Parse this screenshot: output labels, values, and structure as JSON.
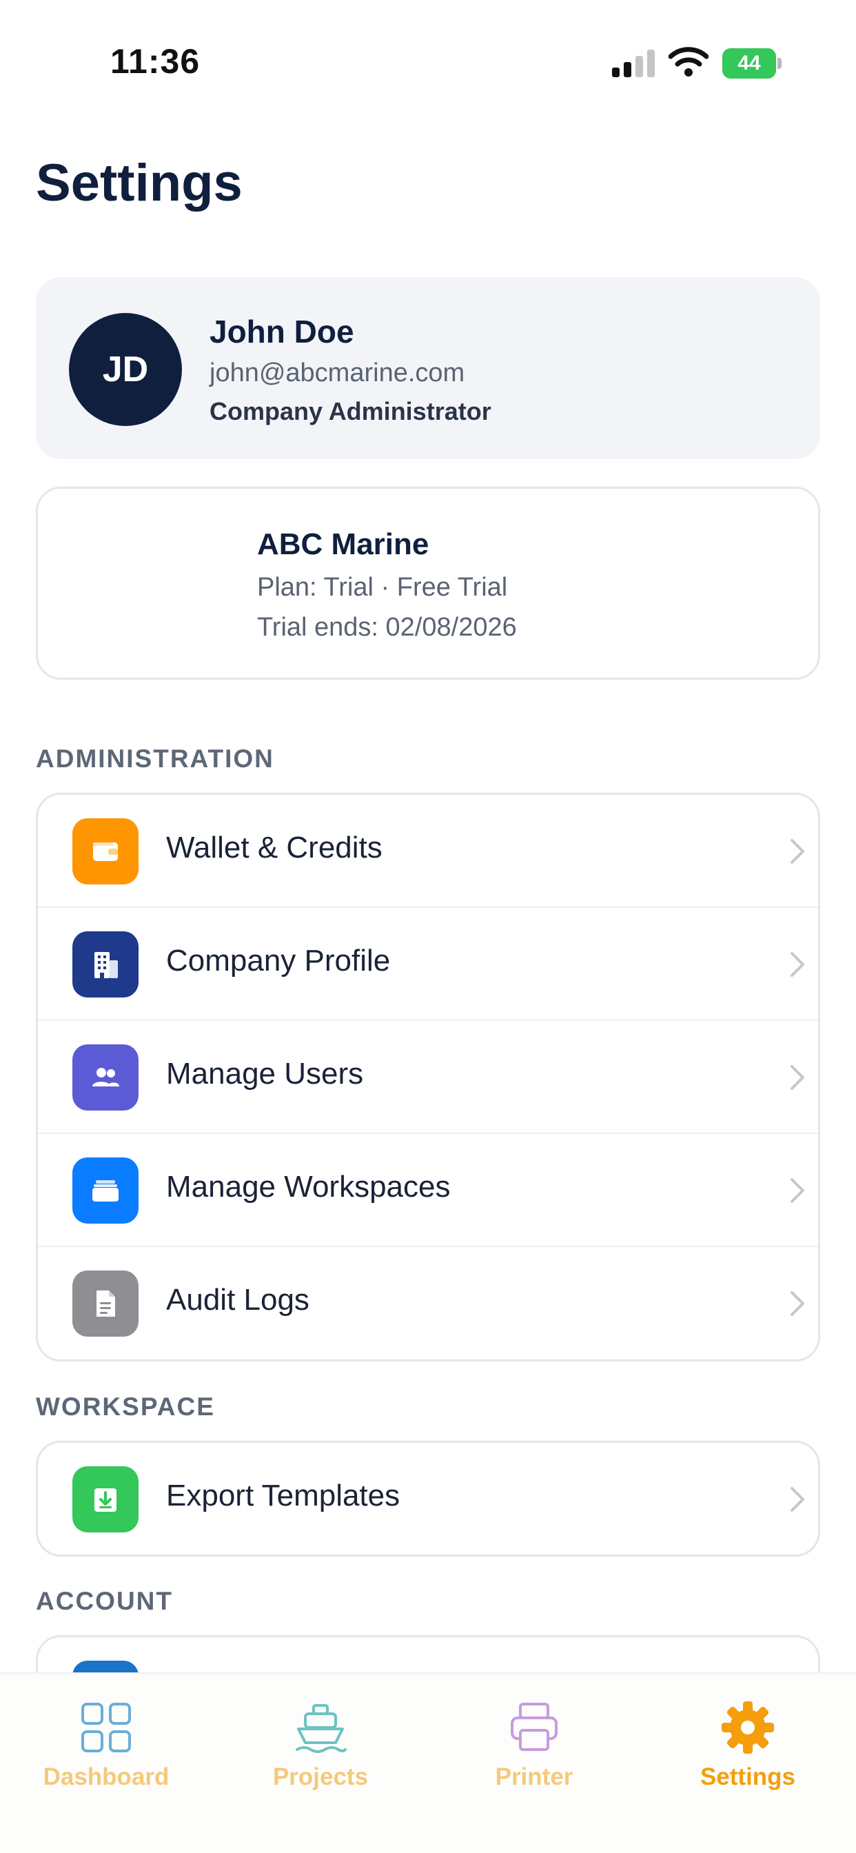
{
  "status_bar": {
    "time": "11:36",
    "battery": "44"
  },
  "page": {
    "title": "Settings"
  },
  "profile": {
    "initials": "JD",
    "name": "John Doe",
    "email": "john@abcmarine.com",
    "role": "Company Administrator"
  },
  "company": {
    "name": "ABC Marine",
    "plan": "Plan: Trial · Free Trial",
    "trial_ends": "Trial ends: 02/08/2026"
  },
  "sections": {
    "administration": {
      "header": "ADMINISTRATION",
      "items": [
        {
          "label": "Wallet & Credits",
          "icon": "wallet-icon",
          "color": "#ff9500"
        },
        {
          "label": "Company Profile",
          "icon": "building-icon",
          "color": "#1f3a8a"
        },
        {
          "label": "Manage Users",
          "icon": "users-icon",
          "color": "#5b5bd6"
        },
        {
          "label": "Manage Workspaces",
          "icon": "folder-icon",
          "color": "#0a7cff"
        },
        {
          "label": "Audit Logs",
          "icon": "document-icon",
          "color": "#8e8e93"
        }
      ]
    },
    "workspace": {
      "header": "WORKSPACE",
      "items": [
        {
          "label": "Export Templates",
          "icon": "download-icon",
          "color": "#34c759"
        }
      ]
    },
    "account": {
      "header": "ACCOUNT",
      "items": [
        {
          "icon": "partially-visible-icon",
          "color": "#1a73c8"
        }
      ]
    }
  },
  "tab_bar": {
    "tabs": [
      {
        "label": "Dashboard",
        "icon": "grid-icon",
        "active": false
      },
      {
        "label": "Projects",
        "icon": "ship-icon",
        "active": false
      },
      {
        "label": "Printer",
        "icon": "printer-icon",
        "active": false
      },
      {
        "label": "Settings",
        "icon": "gear-icon",
        "active": true
      }
    ],
    "active_color": "#f59e0b",
    "inactive_label_color": "#f5c97a"
  }
}
